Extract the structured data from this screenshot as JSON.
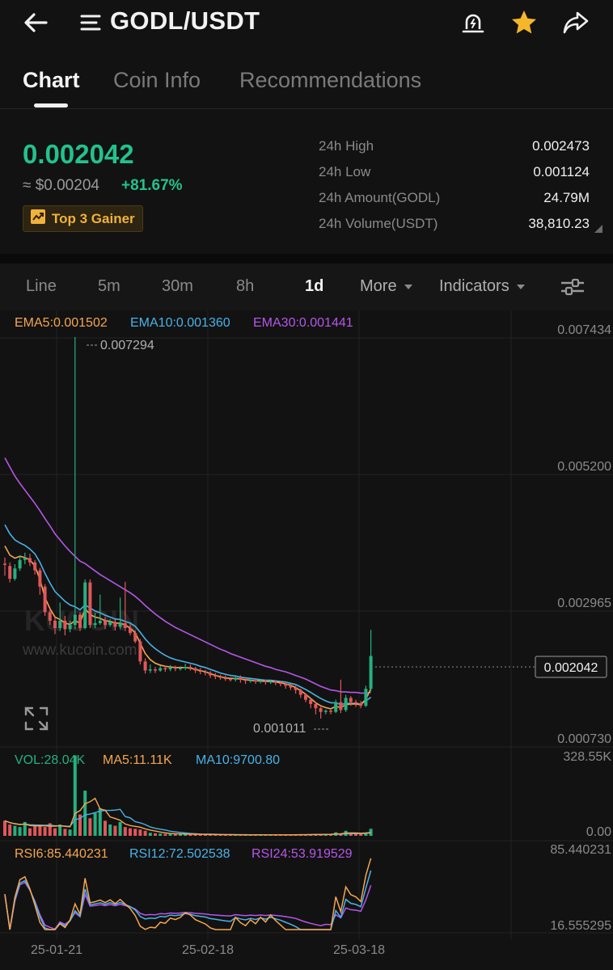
{
  "header": {
    "pair": "GODL/USDT",
    "icons": [
      "arrow-left-icon",
      "menu-lines-icon",
      "price-alert-icon",
      "star-icon",
      "share-icon"
    ]
  },
  "tabs": [
    {
      "label": "Chart",
      "active": true
    },
    {
      "label": "Coin Info",
      "active": false
    },
    {
      "label": "Recommendations",
      "active": false
    }
  ],
  "ticker": {
    "last_price": "0.002042",
    "fiat_price": "≈ $0.00204",
    "change": "+81.67%",
    "badge": "Top 3 Gainer",
    "stats": [
      {
        "label": "24h High",
        "value": "0.002473"
      },
      {
        "label": "24h Low",
        "value": "0.001124"
      },
      {
        "label": "24h Amount(GODL)",
        "value": "24.79M"
      },
      {
        "label": "24h Volume(USDT)",
        "value": "38,810.23"
      }
    ]
  },
  "intervals": {
    "items": [
      "Line",
      "5m",
      "30m",
      "8h",
      "1d"
    ],
    "active": "1d",
    "more": "More",
    "indicators": "Indicators"
  },
  "chart_data": {
    "type": "candlestick",
    "interval": "1d",
    "legend": {
      "ema": [
        "EMA5:0.001502",
        "EMA10:0.001360",
        "EMA30:0.001441"
      ],
      "vol": [
        "VOL:28.04K",
        "MA5:11.11K",
        "MA10:9700.80"
      ],
      "rsi": [
        "RSI6:85.440231",
        "RSI12:72.502538",
        "RSI24:53.919529"
      ]
    },
    "price_axis": [
      "0.007434",
      "0.005200",
      "0.002965",
      "0.000730"
    ],
    "price_range": [
      0.00073,
      0.007434
    ],
    "volume_axis": [
      "328.55K",
      "0.00"
    ],
    "rsi_axis": [
      "85.440231",
      "16.555295"
    ],
    "x_ticks": [
      "25-01-21",
      "25-02-18",
      "25-03-18"
    ],
    "current_price_tag": "0.002042",
    "high_marker": "0.007294",
    "low_marker": "0.001011",
    "watermark": "www.kucoin.com",
    "logo_text": "KUCOIN",
    "colors": {
      "up": "#26b07f",
      "down": "#e0575a",
      "ema5": "#f5a650",
      "ema10": "#4ab2e8",
      "ema30": "#b557e8"
    },
    "candles": [
      [
        0.00356,
        0.00354,
        0.00366,
        0.00336
      ],
      [
        0.00352,
        0.00331,
        0.00358,
        0.00325
      ],
      [
        0.00331,
        0.00348,
        0.00355,
        0.00328
      ],
      [
        0.00348,
        0.00362,
        0.0037,
        0.00344
      ],
      [
        0.00362,
        0.00365,
        0.00374,
        0.00355
      ],
      [
        0.00365,
        0.00358,
        0.00372,
        0.00352
      ],
      [
        0.00358,
        0.00345,
        0.00362,
        0.00338
      ],
      [
        0.00345,
        0.00318,
        0.00349,
        0.00305
      ],
      [
        0.00318,
        0.00276,
        0.00322,
        0.0027
      ],
      [
        0.00276,
        0.00262,
        0.00282,
        0.00255
      ],
      [
        0.00262,
        0.0025,
        0.00268,
        0.0024
      ],
      [
        0.0025,
        0.00262,
        0.00292,
        0.00245
      ],
      [
        0.00262,
        0.00248,
        0.0027,
        0.00238
      ],
      [
        0.00248,
        0.00255,
        0.00262,
        0.00243
      ],
      [
        0.00255,
        0.00272,
        0.00729,
        0.00248
      ],
      [
        0.00272,
        0.0025,
        0.00276,
        0.00245
      ],
      [
        0.0025,
        0.00325,
        0.0033,
        0.00248
      ],
      [
        0.00325,
        0.00255,
        0.0033,
        0.0025
      ],
      [
        0.00255,
        0.00258,
        0.00275,
        0.0025
      ],
      [
        0.00258,
        0.00262,
        0.00305,
        0.00255
      ],
      [
        0.00262,
        0.00255,
        0.00268,
        0.00248
      ],
      [
        0.00255,
        0.0026,
        0.00265,
        0.00252
      ],
      [
        0.0026,
        0.00252,
        0.00264,
        0.00246
      ],
      [
        0.00252,
        0.00258,
        0.003,
        0.00248
      ],
      [
        0.00258,
        0.0025,
        0.00326,
        0.00245
      ],
      [
        0.0025,
        0.00242,
        0.00256,
        0.00238
      ],
      [
        0.00242,
        0.00228,
        0.00246,
        0.00225
      ],
      [
        0.00228,
        0.00195,
        0.00232,
        0.0019
      ],
      [
        0.00195,
        0.0018,
        0.002,
        0.00175
      ],
      [
        0.0018,
        0.00182,
        0.0019,
        0.00176
      ],
      [
        0.00182,
        0.0018,
        0.00186,
        0.00176
      ],
      [
        0.0018,
        0.00184,
        0.00188,
        0.00178
      ],
      [
        0.00184,
        0.00182,
        0.00188,
        0.00178
      ],
      [
        0.00182,
        0.00185,
        0.00189,
        0.00179
      ],
      [
        0.00185,
        0.00183,
        0.00188,
        0.00179
      ],
      [
        0.00183,
        0.00184,
        0.00187,
        0.0018
      ],
      [
        0.00184,
        0.00186,
        0.00191,
        0.00181
      ],
      [
        0.00186,
        0.00184,
        0.0019,
        0.0018
      ],
      [
        0.00184,
        0.0018,
        0.00186,
        0.00176
      ],
      [
        0.0018,
        0.00178,
        0.00184,
        0.00174
      ],
      [
        0.00178,
        0.00176,
        0.00181,
        0.00172
      ],
      [
        0.00176,
        0.00172,
        0.00179,
        0.00168
      ],
      [
        0.00172,
        0.0017,
        0.00176,
        0.00166
      ],
      [
        0.0017,
        0.00168,
        0.00173,
        0.00165
      ],
      [
        0.00168,
        0.00166,
        0.00172,
        0.00163
      ],
      [
        0.00166,
        0.00165,
        0.00169,
        0.00162
      ],
      [
        0.00165,
        0.00168,
        0.00171,
        0.00162
      ],
      [
        0.00168,
        0.00165,
        0.00172,
        0.0016
      ],
      [
        0.00165,
        0.00163,
        0.00168,
        0.00158
      ],
      [
        0.00163,
        0.00164,
        0.00167,
        0.0016
      ],
      [
        0.00164,
        0.00162,
        0.00166,
        0.00158
      ],
      [
        0.00162,
        0.00163,
        0.00166,
        0.00159
      ],
      [
        0.00163,
        0.00161,
        0.00165,
        0.00157
      ],
      [
        0.00161,
        0.00162,
        0.00165,
        0.00158
      ],
      [
        0.00162,
        0.0016,
        0.00164,
        0.00156
      ],
      [
        0.0016,
        0.00158,
        0.00163,
        0.00154
      ],
      [
        0.00158,
        0.00155,
        0.00161,
        0.0015
      ],
      [
        0.00155,
        0.00152,
        0.00158,
        0.00148
      ],
      [
        0.00152,
        0.00148,
        0.00155,
        0.00142
      ],
      [
        0.00148,
        0.0014,
        0.0015,
        0.00135
      ],
      [
        0.0014,
        0.00132,
        0.00142,
        0.00128
      ],
      [
        0.00132,
        0.00125,
        0.00135,
        0.00118
      ],
      [
        0.00125,
        0.00118,
        0.00128,
        0.00108
      ],
      [
        0.00118,
        0.00112,
        0.0012,
        0.00101
      ],
      [
        0.00112,
        0.00114,
        0.00116,
        0.00108
      ],
      [
        0.00114,
        0.00112,
        0.00117,
        0.00108
      ],
      [
        0.00112,
        0.00128,
        0.00132,
        0.0011
      ],
      [
        0.00128,
        0.00115,
        0.00165,
        0.0011
      ],
      [
        0.00115,
        0.00135,
        0.0014,
        0.00112
      ],
      [
        0.00135,
        0.00128,
        0.00138,
        0.00122
      ],
      [
        0.00128,
        0.00126,
        0.00132,
        0.0012
      ],
      [
        0.00126,
        0.00122,
        0.0013,
        0.00118
      ],
      [
        0.00122,
        0.0015,
        0.00155,
        0.0012
      ],
      [
        0.0015,
        0.00204,
        0.00247,
        0.00146
      ]
    ],
    "ema": {
      "ema5": [
        0.00385,
        0.0037,
        0.00365,
        0.00368,
        0.00366,
        0.00362,
        0.00352,
        0.0033,
        0.003,
        0.00282,
        0.00268,
        0.00264,
        0.00258,
        0.00256,
        0.00262,
        0.00258,
        0.00282,
        0.00272,
        0.00268,
        0.00266,
        0.00262,
        0.00261,
        0.00258,
        0.00258,
        0.00255,
        0.0025,
        0.00242,
        0.00225,
        0.00208,
        0.00198,
        0.00192,
        0.00189,
        0.00187,
        0.00186,
        0.00185,
        0.00185,
        0.00185,
        0.00184,
        0.00182,
        0.0018,
        0.00178,
        0.00175,
        0.00172,
        0.0017,
        0.00168,
        0.00167,
        0.00167,
        0.00166,
        0.00165,
        0.00164,
        0.00163,
        0.00163,
        0.00162,
        0.00162,
        0.00161,
        0.0016,
        0.00158,
        0.00156,
        0.00152,
        0.00147,
        0.00141,
        0.00134,
        0.00127,
        0.00122,
        0.00119,
        0.00117,
        0.00121,
        0.00119,
        0.00124,
        0.00125,
        0.00125,
        0.00124,
        0.00133,
        0.0015
      ],
      "ema10": [
        0.0042,
        0.00405,
        0.00395,
        0.0039,
        0.00386,
        0.0038,
        0.00372,
        0.00358,
        0.0034,
        0.00324,
        0.0031,
        0.00302,
        0.00294,
        0.00288,
        0.00285,
        0.0028,
        0.00288,
        0.00283,
        0.00278,
        0.00275,
        0.00271,
        0.00268,
        0.00265,
        0.00264,
        0.00261,
        0.00258,
        0.00253,
        0.00243,
        0.00232,
        0.00223,
        0.00216,
        0.0021,
        0.00205,
        0.00201,
        0.00198,
        0.00196,
        0.00194,
        0.00192,
        0.0019,
        0.00187,
        0.00185,
        0.00182,
        0.00179,
        0.00176,
        0.00174,
        0.00172,
        0.00171,
        0.00169,
        0.00168,
        0.00167,
        0.00166,
        0.00165,
        0.00164,
        0.00164,
        0.00163,
        0.00162,
        0.00161,
        0.00159,
        0.00157,
        0.00153,
        0.00149,
        0.00144,
        0.00139,
        0.00134,
        0.0013,
        0.00127,
        0.00127,
        0.00124,
        0.00126,
        0.00126,
        0.00126,
        0.00125,
        0.0013,
        0.00136
      ],
      "ema30": [
        0.0053,
        0.00515,
        0.005,
        0.00488,
        0.00477,
        0.00466,
        0.00455,
        0.00443,
        0.0043,
        0.00418,
        0.00405,
        0.00395,
        0.00385,
        0.00376,
        0.00368,
        0.0036,
        0.00356,
        0.0035,
        0.00344,
        0.00338,
        0.00333,
        0.00328,
        0.00323,
        0.00318,
        0.00313,
        0.00308,
        0.00302,
        0.00295,
        0.00287,
        0.0028,
        0.00273,
        0.00267,
        0.00261,
        0.00256,
        0.00251,
        0.00247,
        0.00243,
        0.00239,
        0.00235,
        0.00231,
        0.00227,
        0.00223,
        0.00219,
        0.00215,
        0.00212,
        0.00208,
        0.00205,
        0.00202,
        0.00199,
        0.00196,
        0.00193,
        0.0019,
        0.00187,
        0.00185,
        0.00182,
        0.0018,
        0.00178,
        0.00175,
        0.00172,
        0.00169,
        0.00166,
        0.00162,
        0.00158,
        0.00154,
        0.00151,
        0.00148,
        0.00147,
        0.00145,
        0.00145,
        0.00144,
        0.00144,
        0.00143,
        0.00143,
        0.00144
      ]
    },
    "volume": [
      60,
      45,
      40,
      35,
      55,
      30,
      38,
      40,
      35,
      50,
      30,
      45,
      28,
      25,
      320,
      85,
      180,
      70,
      90,
      110,
      60,
      45,
      40,
      55,
      35,
      30,
      28,
      25,
      20,
      12,
      10,
      9,
      8,
      8,
      7,
      7,
      6,
      6,
      6,
      5,
      5,
      5,
      5,
      4,
      4,
      4,
      4,
      4,
      4,
      4,
      4,
      4,
      4,
      4,
      4,
      4,
      4,
      4,
      5,
      5,
      5,
      6,
      6,
      6,
      6,
      7,
      14,
      7,
      20,
      8,
      8,
      9,
      12,
      28
    ],
    "volume_max": 328550
  }
}
